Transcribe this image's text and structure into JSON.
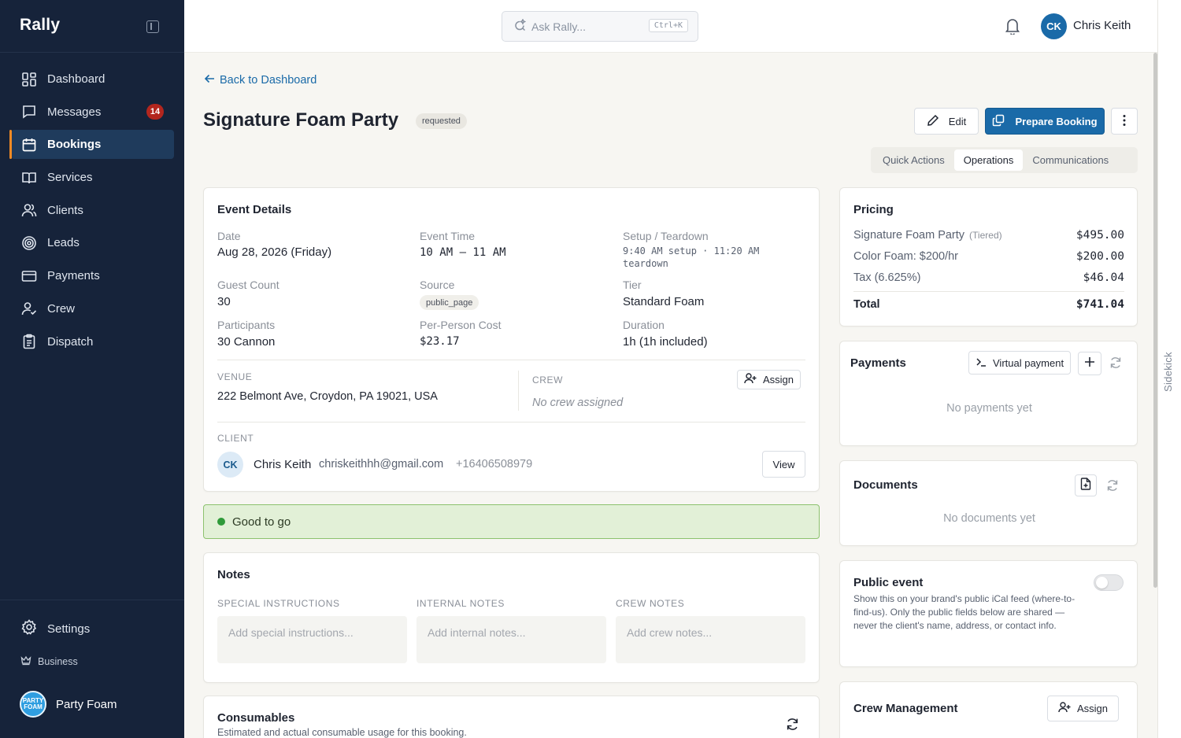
{
  "sidebar": {
    "brand": "Rally",
    "items": [
      {
        "label": "Dashboard",
        "icon": "dashboard-icon"
      },
      {
        "label": "Messages",
        "icon": "message-icon",
        "badge": "14"
      },
      {
        "label": "Bookings",
        "icon": "calendar-icon",
        "active": true
      },
      {
        "label": "Services",
        "icon": "book-icon"
      },
      {
        "label": "Clients",
        "icon": "users-icon"
      },
      {
        "label": "Leads",
        "icon": "target-icon"
      },
      {
        "label": "Payments",
        "icon": "card-icon"
      },
      {
        "label": "Crew",
        "icon": "user-check-icon"
      },
      {
        "label": "Dispatch",
        "icon": "clipboard-icon"
      }
    ],
    "settings_label": "Settings",
    "plan_label": "Business",
    "org_name": "Party Foam",
    "org_logo_text": "PARTY FOAM"
  },
  "topbar": {
    "search_placeholder": "Ask Rally...",
    "shortcut": "Ctrl+K",
    "user_initials": "CK",
    "user_name": "Chris Keith"
  },
  "rail": {
    "label": "Sidekick"
  },
  "page": {
    "back_label": "Back to Dashboard",
    "title": "Signature Foam Party",
    "status": "requested",
    "edit_label": "Edit",
    "primary_label": "Prepare Booking",
    "tabs": [
      "Quick Actions",
      "Operations",
      "Communications"
    ],
    "active_tab": "Operations"
  },
  "event_details": {
    "title": "Event Details",
    "date_label": "Date",
    "date_value": "Aug 28, 2026 (Friday)",
    "time_label": "Event Time",
    "time_value": "10 AM – 11 AM",
    "setup_label": "Setup / Teardown",
    "setup_value": "9:40 AM setup · 11:20 AM teardown",
    "guest_label": "Guest Count",
    "guest_value": "30",
    "source_label": "Source",
    "source_value": "public_page",
    "tier_label": "Tier",
    "tier_value": "Standard Foam",
    "participants_label": "Participants",
    "participants_value": "30 Cannon",
    "perperson_label": "Per-Person Cost",
    "perperson_value": "$23.17",
    "duration_label": "Duration",
    "duration_value": "1h (1h included)",
    "venue_label": "VENUE",
    "venue_value": "222 Belmont Ave, Croydon, PA 19021, USA",
    "crew_label": "CREW",
    "crew_value": "No crew assigned",
    "assign_label": "Assign",
    "client_label": "CLIENT",
    "client_initials": "CK",
    "client_name": "Chris Keith",
    "client_email": "chriskeithhh@gmail.com",
    "client_phone": "+16406508979",
    "view_label": "View"
  },
  "status_banner": "Good to go",
  "notes": {
    "title": "Notes",
    "special_label": "SPECIAL INSTRUCTIONS",
    "special_placeholder": "Add special instructions...",
    "internal_label": "INTERNAL NOTES",
    "internal_placeholder": "Add internal notes...",
    "crew_label": "CREW NOTES",
    "crew_placeholder": "Add crew notes..."
  },
  "consumables": {
    "title": "Consumables",
    "subtitle": "Estimated and actual consumable usage for this booking."
  },
  "pricing": {
    "title": "Pricing",
    "rows": [
      {
        "label": "Signature Foam Party",
        "tag": "(Tiered)",
        "amount": "$495.00"
      },
      {
        "label": "Color Foam: $200/hr",
        "tag": "",
        "amount": "$200.00"
      },
      {
        "label": "Tax (6.625%)",
        "tag": "",
        "amount": "$46.04"
      }
    ],
    "total_label": "Total",
    "total_amount": "$741.04"
  },
  "payments": {
    "title": "Payments",
    "virtual_label": "Virtual payment",
    "empty": "No payments yet"
  },
  "documents": {
    "title": "Documents",
    "empty": "No documents yet"
  },
  "public_event": {
    "title": "Public event",
    "description": "Show this on your brand's public iCal feed (where-to-find-us). Only the public fields below are shared — never the client's name, address, or contact info."
  },
  "crew_management": {
    "title": "Crew Management",
    "assign_label": "Assign"
  }
}
